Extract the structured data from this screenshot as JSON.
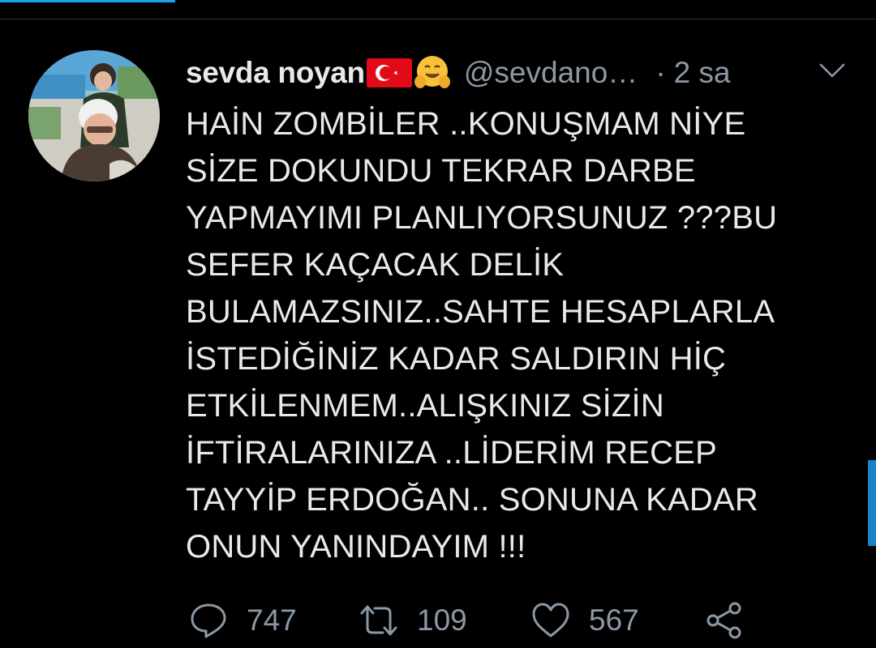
{
  "tweet": {
    "author": {
      "display_name": "sevda noyan",
      "handle": "@sevdano…",
      "flag_icon": "turkey-flag-icon",
      "emoji_icon": "hugging-face-icon"
    },
    "separator": "·",
    "timestamp": "2 sa",
    "text_lines": [
      "HAİN ZOMBİLER ..KONUŞMAM NİYE",
      "SİZE DOKUNDU TEKRAR DARBE",
      "YAPMAYIMI PLANLIYORSUNUZ ???BU",
      "SEFER KAÇACAK DELİK",
      "BULAMAZSINIZ..SAHTE HESAPLARLA",
      "İSTEDİĞİNİZ KADAR SALDIRIN HİÇ",
      "ETKİLENMEM..ALIŞKINIZ SİZİN",
      "İFTİRALARINIZA ..LİDERİM RECEP",
      "TAYYİP ERDOĞAN.. SONUNA KADAR",
      "ONUN YANINDAYIM !!!"
    ],
    "actions": {
      "reply_count": "747",
      "retweet_count": "109",
      "like_count": "567"
    }
  },
  "colors": {
    "background": "#000000",
    "text": "#e7e9ea",
    "muted": "#8b98a5",
    "accent": "#1da1f2"
  }
}
